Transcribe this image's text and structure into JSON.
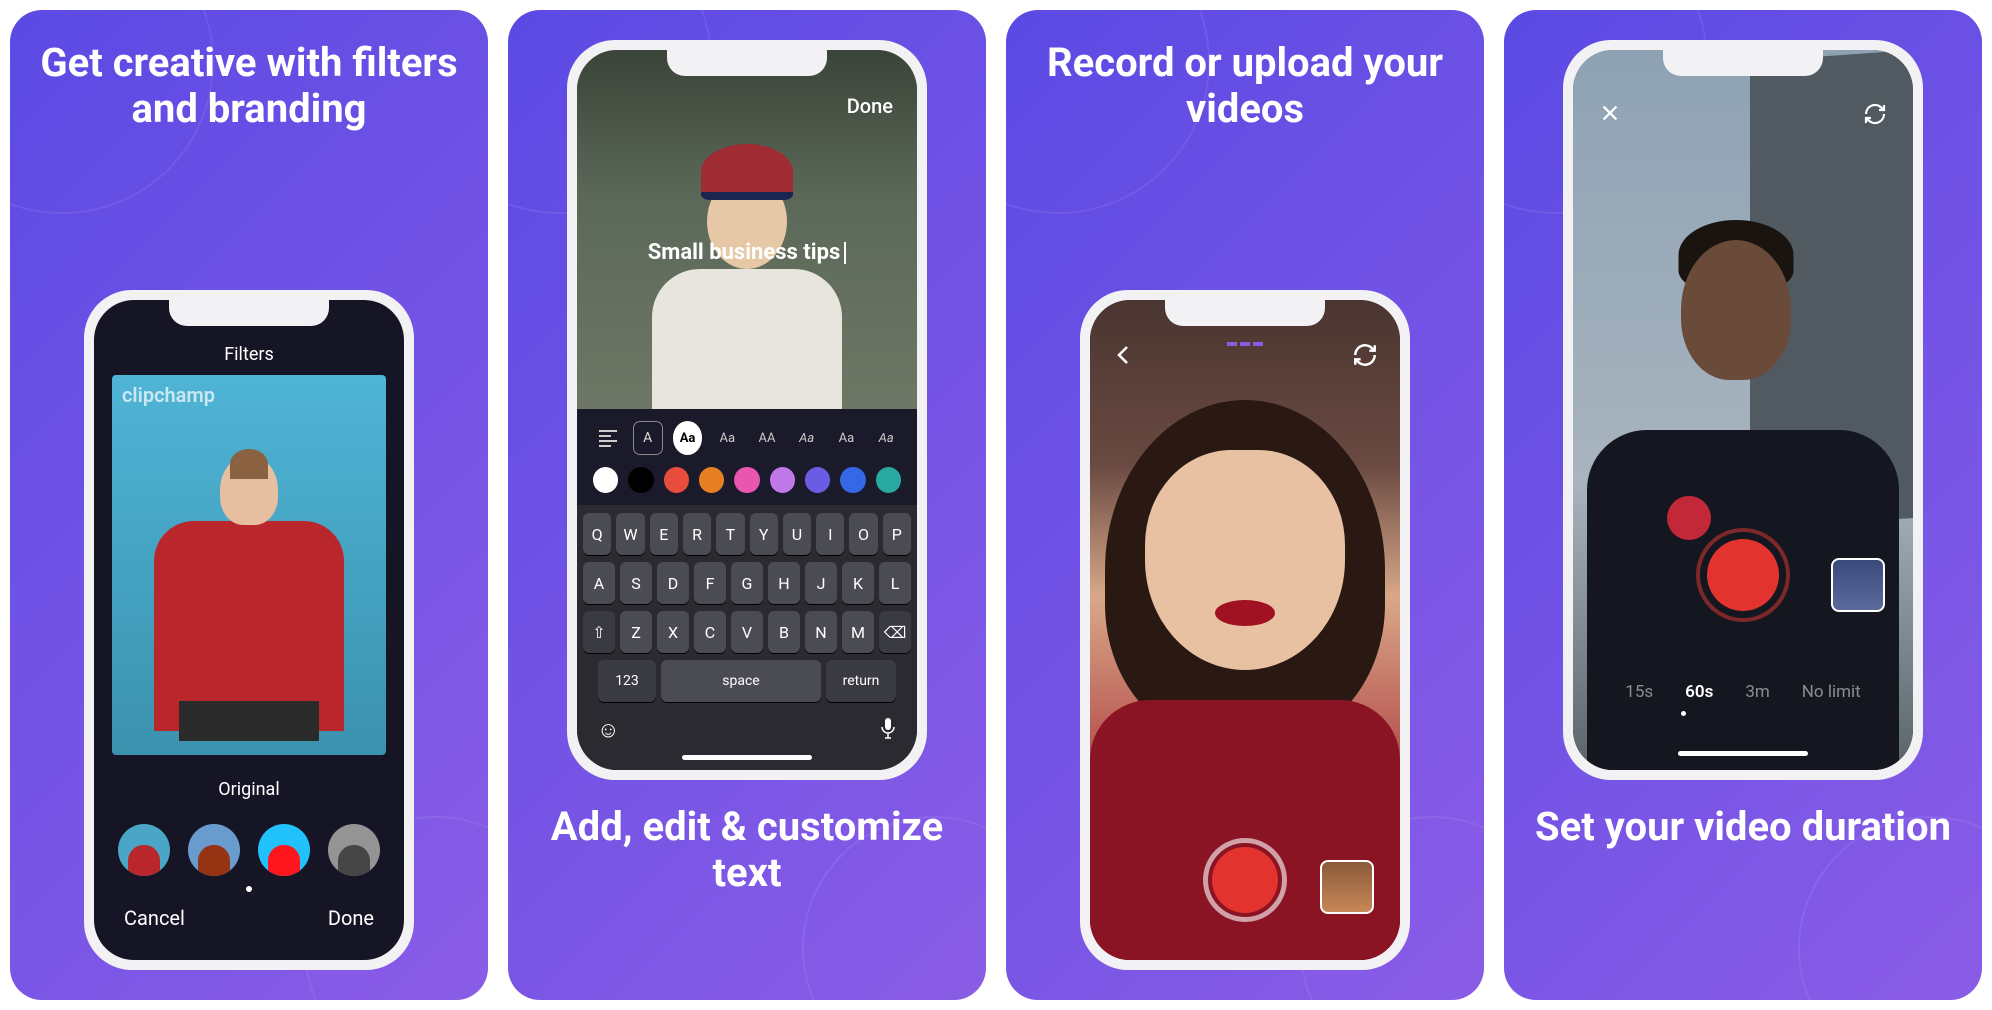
{
  "cards": [
    {
      "title": "Get creative with filters and branding",
      "phone": {
        "header": "Filters",
        "watermark": "clipchamp",
        "filter_label": "Original",
        "cancel": "Cancel",
        "done": "Done"
      }
    },
    {
      "title": "Add, edit & customize text",
      "phone": {
        "done": "Done",
        "overlay_text": "Small business tips",
        "font_options": [
          "Aa",
          "Aa",
          "AA",
          "Aa",
          "Aa",
          "Aa"
        ],
        "colors": [
          "#ffffff",
          "#000000",
          "#e74c3c",
          "#e67e22",
          "#e956b0",
          "#c178e8",
          "#6b5ce6",
          "#3468e6",
          "#28a8a0"
        ],
        "keyboard": {
          "row1": [
            "Q",
            "W",
            "E",
            "R",
            "T",
            "Y",
            "U",
            "I",
            "O",
            "P"
          ],
          "row2": [
            "A",
            "S",
            "D",
            "F",
            "G",
            "H",
            "J",
            "K",
            "L"
          ],
          "row3": [
            "Z",
            "X",
            "C",
            "V",
            "B",
            "N",
            "M"
          ],
          "num": "123",
          "space": "space",
          "return": "return"
        }
      }
    },
    {
      "title": "Record or upload your videos"
    },
    {
      "title": "Set your video duration",
      "phone": {
        "durations": [
          "15s",
          "60s",
          "3m",
          "No limit"
        ],
        "active_duration": "60s"
      }
    }
  ]
}
